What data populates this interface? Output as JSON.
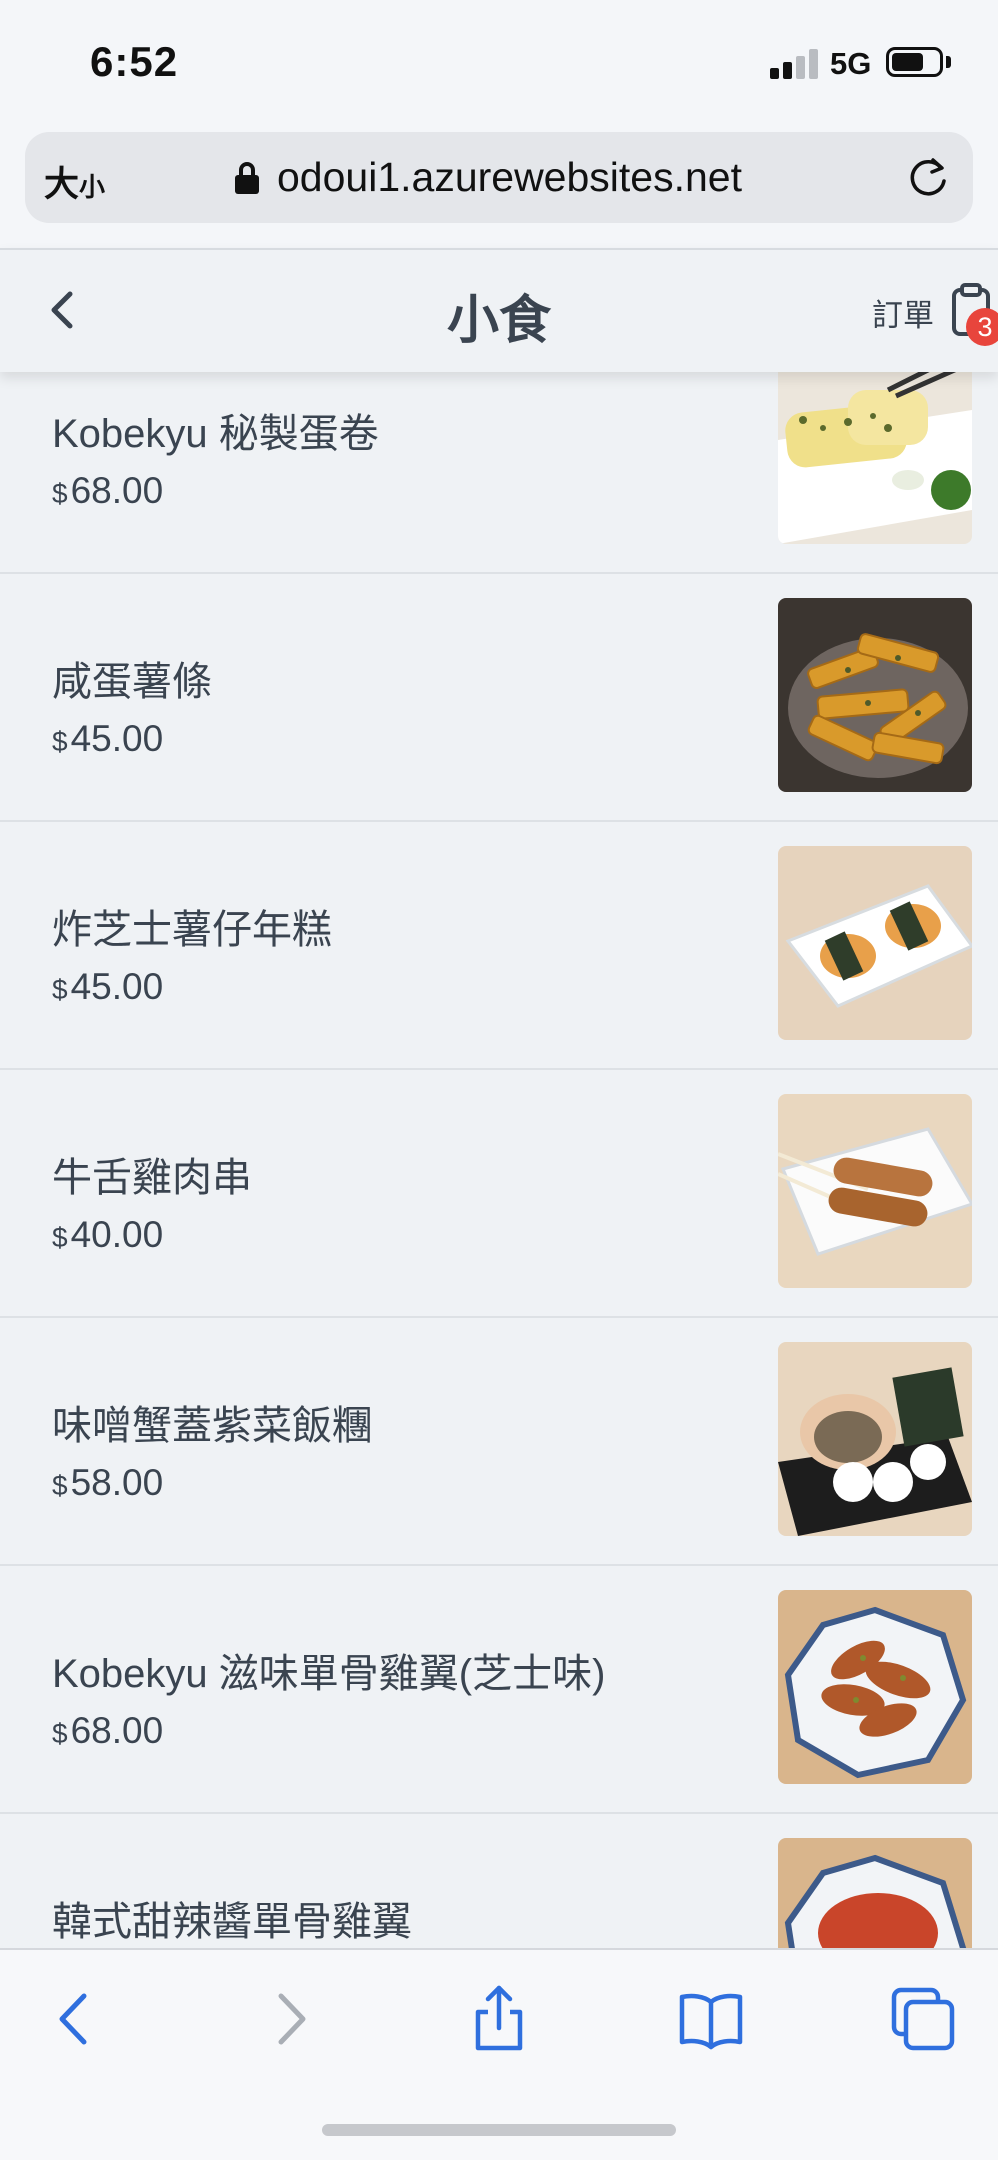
{
  "status_bar": {
    "time": "6:52",
    "network": "5G"
  },
  "browser": {
    "text_size_big": "大",
    "text_size_small": "小",
    "url": "odoui1.azurewebsites.net"
  },
  "nav": {
    "title": "小食",
    "order_label": "訂單",
    "cart_count": "3"
  },
  "items": [
    {
      "name": "Kobekyu 秘製蛋卷",
      "currency": "$",
      "price": "68.00"
    },
    {
      "name": "咸蛋薯條",
      "currency": "$",
      "price": "45.00"
    },
    {
      "name": "炸芝士薯仔年糕",
      "currency": "$",
      "price": "45.00"
    },
    {
      "name": "牛舌雞肉串",
      "currency": "$",
      "price": "40.00"
    },
    {
      "name": "味噌蟹蓋紫菜飯糰",
      "currency": "$",
      "price": "58.00"
    },
    {
      "name": "Kobekyu 滋味單骨雞翼(芝士味)",
      "currency": "$",
      "price": "68.00"
    },
    {
      "name": "韓式甜辣醬單骨雞翼",
      "currency": "$",
      "price": ""
    }
  ],
  "colors": {
    "accent": "#2f6fde",
    "badge": "#e8453c",
    "text": "#3a4450"
  },
  "toolbar_icons": [
    "back-icon",
    "forward-icon",
    "share-icon",
    "bookmarks-icon",
    "tabs-icon"
  ]
}
